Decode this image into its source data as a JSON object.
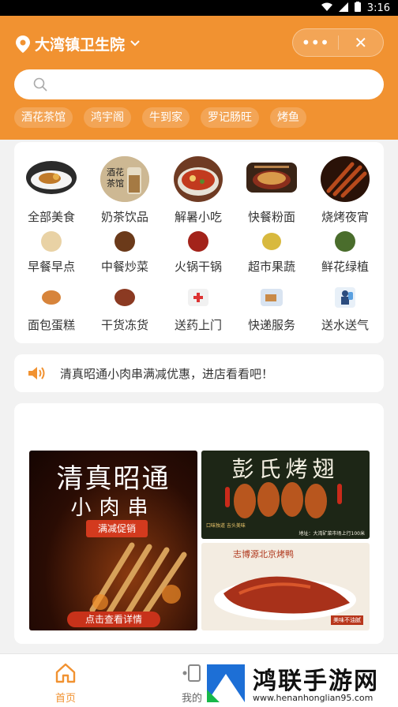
{
  "status_bar": {
    "time": "3:16"
  },
  "header": {
    "location": "大湾镇卫生院",
    "more_glyph": "•••",
    "close_glyph": "✕",
    "search_placeholder": "",
    "tags": [
      "酒花茶馆",
      "鸿宇阁",
      "牛到家",
      "罗记肠旺",
      "烤鱼"
    ]
  },
  "categories": [
    {
      "label": "全部美食",
      "icon": "food-plate-icon"
    },
    {
      "label": "奶茶饮品",
      "icon": "milk-tea-icon"
    },
    {
      "label": "解暑小吃",
      "icon": "snack-bowl-icon"
    },
    {
      "label": "快餐粉面",
      "icon": "noodles-icon"
    },
    {
      "label": "烧烤夜宵",
      "icon": "bbq-icon"
    },
    {
      "label": "早餐早点",
      "icon": "breakfast-icon"
    },
    {
      "label": "中餐炒菜",
      "icon": "chinese-dish-icon"
    },
    {
      "label": "火锅干锅",
      "icon": "hotpot-icon"
    },
    {
      "label": "超市果蔬",
      "icon": "fruit-veg-icon"
    },
    {
      "label": "鲜花绿植",
      "icon": "flower-icon"
    },
    {
      "label": "面包蛋糕",
      "icon": "bread-icon"
    },
    {
      "label": "干货冻货",
      "icon": "dried-goods-icon"
    },
    {
      "label": "送药上门",
      "icon": "medicine-icon"
    },
    {
      "label": "快递服务",
      "icon": "express-icon"
    },
    {
      "label": "送水送气",
      "icon": "water-delivery-icon"
    }
  ],
  "category_tile_text": "酒花茶馆",
  "notice": {
    "text": "清真昭通小肉串满减优惠，进店看看吧！"
  },
  "promos": {
    "banner1": {
      "title": "清真昭通",
      "subtitle": "小肉串",
      "tag": "满减促销",
      "button": "点击查看详情"
    },
    "banner2": {
      "title": "彭氏烤翅",
      "note": "口味独道 吉头美味",
      "address": "地址：大湾矿菜市场上行100米"
    },
    "banner3": {
      "title": "志博源北京烤鸭",
      "tag": "美味不油腻"
    }
  },
  "tabs": [
    {
      "label": "首页",
      "active": true
    },
    {
      "label": "我的",
      "active": false
    }
  ],
  "watermark": {
    "title": "鸿联手游网",
    "url": "www.henanhonglian95.com"
  },
  "colors": {
    "brand": "#f19231",
    "text": "#333333",
    "background": "#f2f2f2"
  }
}
